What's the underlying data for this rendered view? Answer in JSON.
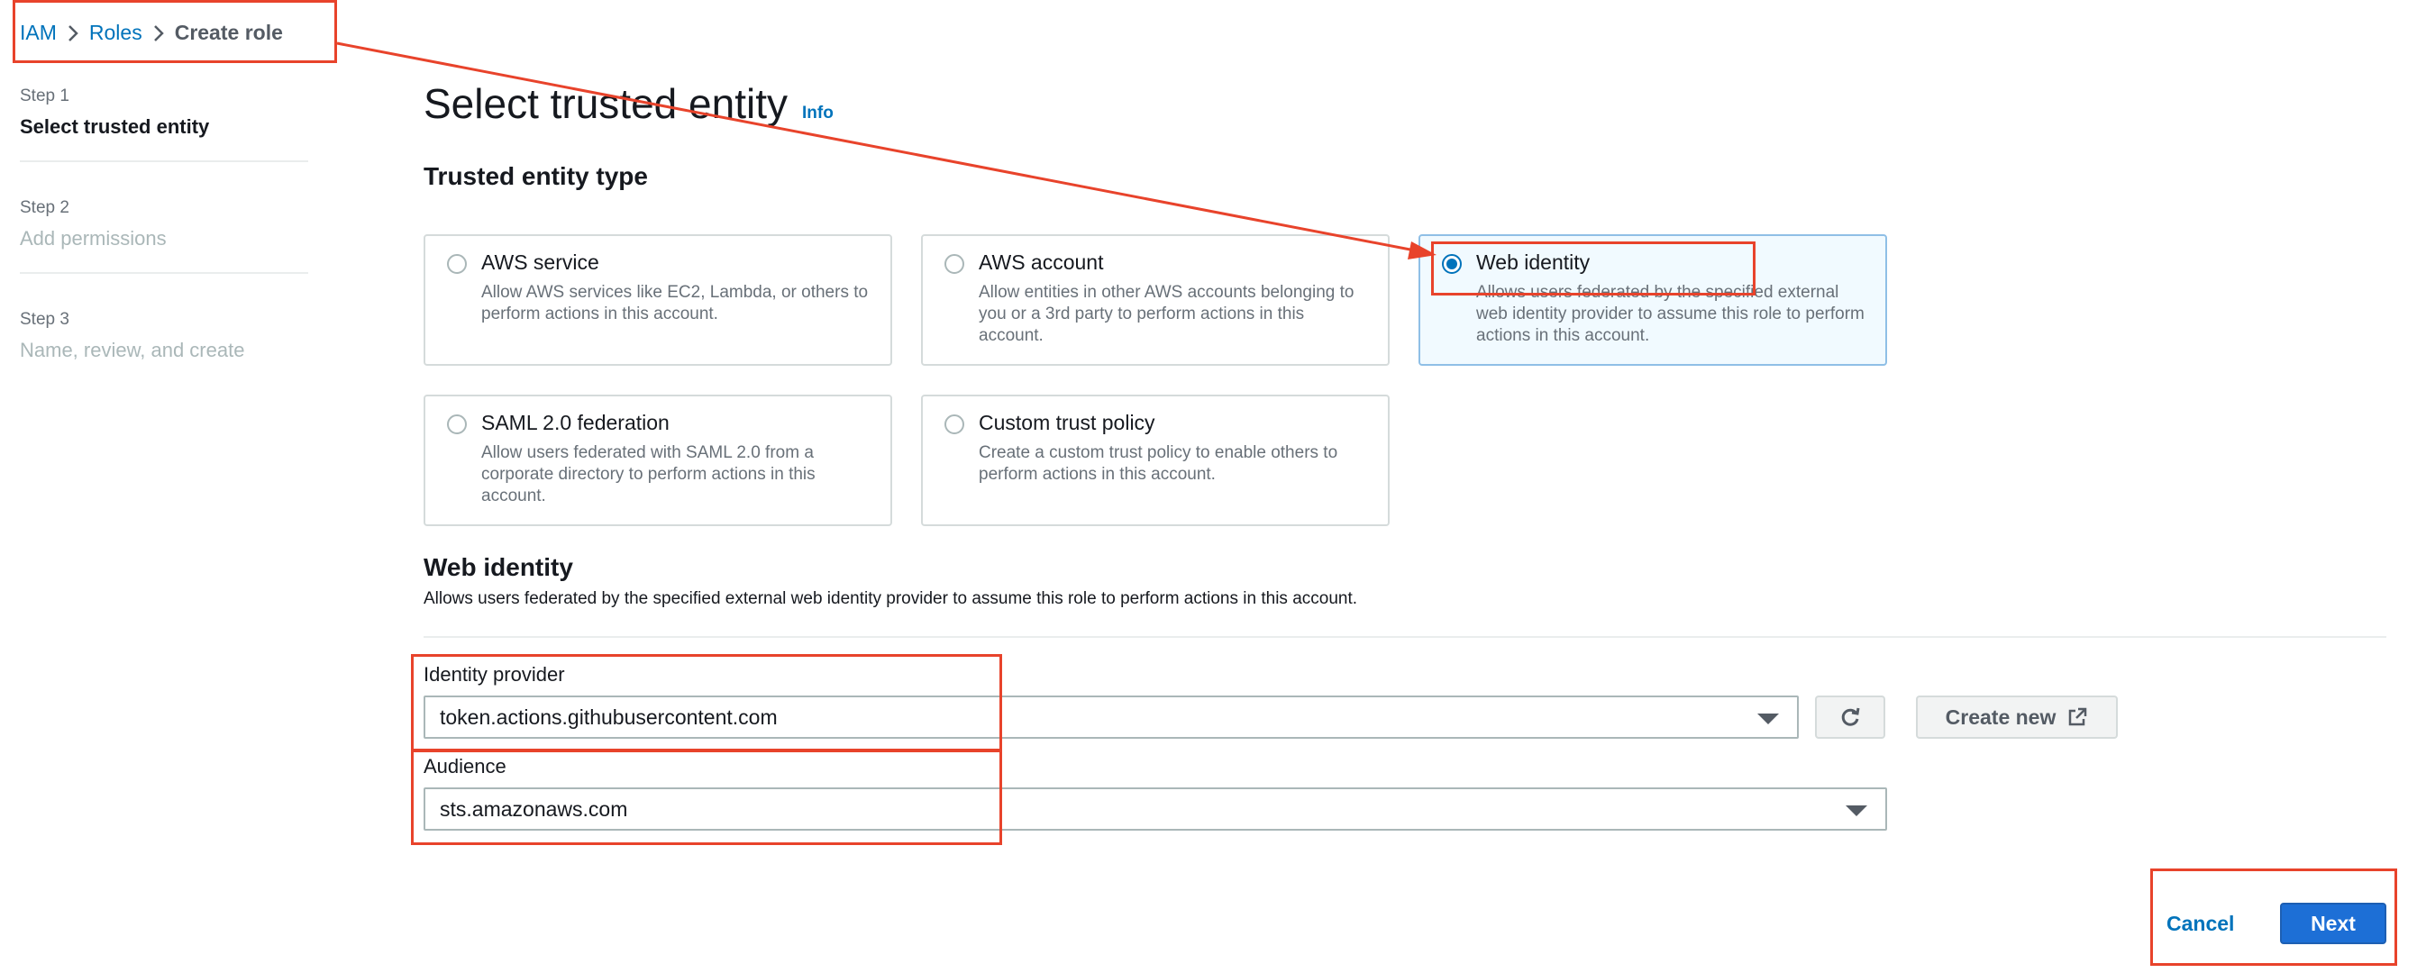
{
  "breadcrumb": {
    "items": [
      "IAM",
      "Roles"
    ],
    "current": "Create role"
  },
  "steps": [
    {
      "num": "Step 1",
      "title": "Select trusted entity"
    },
    {
      "num": "Step 2",
      "title": "Add permissions"
    },
    {
      "num": "Step 3",
      "title": "Name, review, and create"
    }
  ],
  "main": {
    "title": "Select trusted entity",
    "info": "Info",
    "entity_section_title": "Trusted entity type",
    "cards": [
      {
        "title": "AWS service",
        "desc": "Allow AWS services like EC2, Lambda, or others to perform actions in this account."
      },
      {
        "title": "AWS account",
        "desc": "Allow entities in other AWS accounts belonging to you or a 3rd party to perform actions in this account."
      },
      {
        "title": "Web identity",
        "desc": "Allows users federated by the specified external web identity provider to assume this role to perform actions in this account."
      },
      {
        "title": "SAML 2.0 federation",
        "desc": "Allow users federated with SAML 2.0 from a corporate directory to perform actions in this account."
      },
      {
        "title": "Custom trust policy",
        "desc": "Create a custom trust policy to enable others to perform actions in this account."
      }
    ],
    "selected_card": "Web identity",
    "web_identity": {
      "title": "Web identity",
      "desc": "Allows users federated by the specified external web identity provider to assume this role to perform actions in this account.",
      "identity_provider_label": "Identity provider",
      "identity_provider_value": "token.actions.githubusercontent.com",
      "create_new_label": "Create new",
      "audience_label": "Audience",
      "audience_value": "sts.amazonaws.com"
    }
  },
  "footer": {
    "cancel_label": "Cancel",
    "next_label": "Next"
  },
  "colors": {
    "link": "#0073bb",
    "primary": "#1d6fd6",
    "annotation": "#e8432b",
    "selected_bg": "#f1faff"
  }
}
